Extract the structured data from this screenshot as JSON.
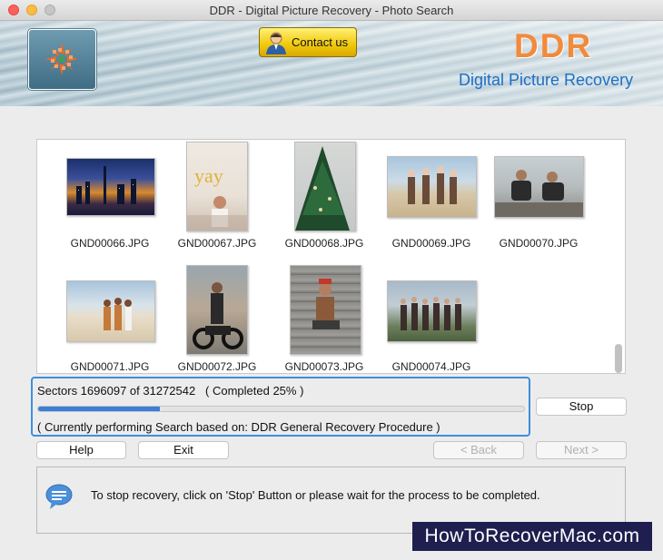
{
  "window": {
    "title": "DDR - Digital Picture Recovery - Photo Search"
  },
  "header": {
    "contact_label": "Contact us",
    "brand": "DDR",
    "brand_subtitle": "Digital Picture Recovery"
  },
  "gallery": {
    "items": [
      {
        "filename": "GND00066.JPG"
      },
      {
        "filename": "GND00067.JPG"
      },
      {
        "filename": "GND00068.JPG"
      },
      {
        "filename": "GND00069.JPG"
      },
      {
        "filename": "GND00070.JPG"
      },
      {
        "filename": "GND00071.JPG"
      },
      {
        "filename": "GND00072.JPG"
      },
      {
        "filename": "GND00073.JPG"
      },
      {
        "filename": "GND00074.JPG"
      }
    ]
  },
  "progress": {
    "sectors_text": "Sectors 1696097 of 31272542   ( Completed 25% )",
    "percent": 25,
    "process_text": "( Currently performing Search based on: DDR General Recovery Procedure )"
  },
  "buttons": {
    "stop": "Stop",
    "help": "Help",
    "exit": "Exit",
    "back": "< Back",
    "next": "Next >"
  },
  "info": {
    "message": "To stop recovery, click on 'Stop' Button or please wait for the process to be completed."
  },
  "watermark": "HowToRecoverMac.com",
  "colors": {
    "accent": "#3b7fd6",
    "brand": "#f28a3c",
    "subtitle": "#1d6fc6"
  }
}
